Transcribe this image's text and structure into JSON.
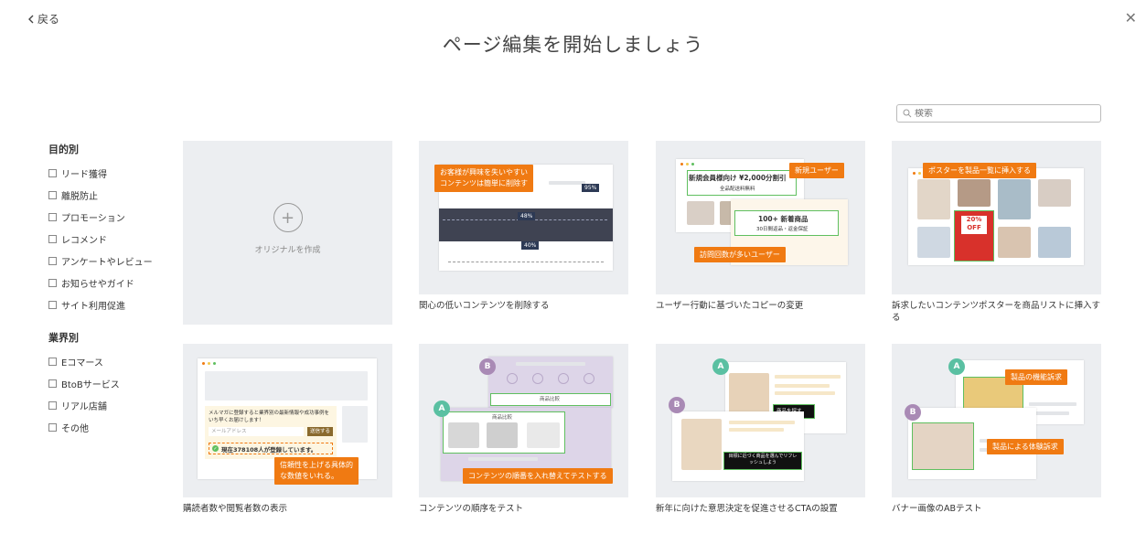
{
  "header": {
    "back_label": "戻る",
    "title": "ページ編集を開始しましょう"
  },
  "search": {
    "placeholder": "検索"
  },
  "sidebar": {
    "purpose_title": "目的別",
    "purpose_items": [
      "リード獲得",
      "離脱防止",
      "プロモーション",
      "レコメンド",
      "アンケートやレビュー",
      "お知らせやガイド",
      "サイト利用促進"
    ],
    "industry_title": "業界別",
    "industry_items": [
      "Eコマース",
      "BtoBサービス",
      "リアル店舗",
      "その他"
    ]
  },
  "cards": {
    "create": {
      "label": "オリジナルを作成"
    },
    "c1": {
      "caption": "関心の低いコンテンツを削除する",
      "callout": "お客様が興味を失いやすい\nコンテンツは簡単に削除す",
      "pct_top": "95%",
      "pct_mid": "48%",
      "pct_low": "40%"
    },
    "c2": {
      "caption": "ユーザー行動に基づいたコピーの変更",
      "tag_new": "新規ユーザー",
      "tag_visit": "訪問回数が多いユーザー",
      "headline": "新規会員様向け ¥2,000分割引",
      "subline": "全品配送料無料",
      "headline2": "100+ 新着商品",
      "subline2": "30日間返品・返金保証"
    },
    "c3": {
      "caption": "訴求したいコンテンツポスターを商品リストに挿入する",
      "tag": "ポスターを製品一覧に挿入する",
      "sale_top": "20%",
      "sale_bottom": "OFF"
    },
    "c4": {
      "caption": "購読者数や閲覧者数の表示",
      "mail_text": "メルマガに登録すると業界別の最新情報や成功事例をいち早くお届けします！",
      "mail_placeholder": "メールアドレス",
      "submit": "送信する",
      "count_text": "現在378108人が登録しています。",
      "callout": "信頼性を上げる具体的\nな数値をいれる。"
    },
    "c5": {
      "caption": "コンテンツの順序をテスト",
      "badge_a": "A",
      "badge_b": "B",
      "section_label": "商品比較",
      "callout": "コンテンツの順番を入れ替えてテストする"
    },
    "c6": {
      "caption": "新年に向けた意思決定を促進させるCTAの設置",
      "badge_a": "A",
      "badge_b": "B",
      "cta_a": "商品を探す",
      "cta_b": "目標に近づく商品を選んでリフレッシュしよう"
    },
    "c7": {
      "caption": "バナー画像のABテスト",
      "badge_a": "A",
      "badge_b": "B",
      "tag_a": "製品の機能訴求",
      "tag_b": "製品による体験訴求"
    }
  },
  "colors": {
    "accent": "#f07a12",
    "badge_green": "#5ac0a2",
    "badge_purple": "#a98ab5",
    "thumb_bg": "#eceef1"
  }
}
